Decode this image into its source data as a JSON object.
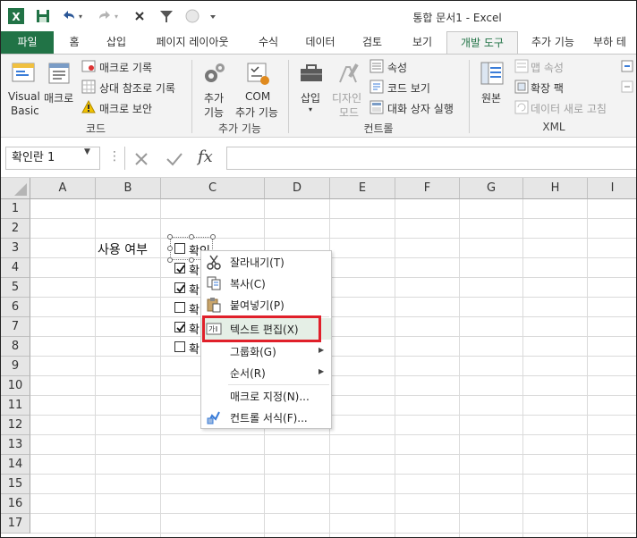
{
  "window": {
    "title": "통합 문서1 - Excel",
    "app_color": "#217346"
  },
  "ribbon": {
    "tabs": [
      {
        "label": "파일"
      },
      {
        "label": "홈"
      },
      {
        "label": "삽입"
      },
      {
        "label": "페이지 레이아웃"
      },
      {
        "label": "수식"
      },
      {
        "label": "데이터"
      },
      {
        "label": "검토"
      },
      {
        "label": "보기"
      },
      {
        "label": "개발 도구"
      },
      {
        "label": "추가 기능"
      },
      {
        "label": "부하 테"
      }
    ],
    "code": {
      "visual_basic_line1": "Visual",
      "visual_basic_line2": "Basic",
      "macro": "매크로",
      "record_macro": "매크로 기록",
      "relative_ref": "상대 참조로 기록",
      "macro_security": "매크로 보안",
      "group_label": "코드"
    },
    "addins": {
      "addins_line1": "추가",
      "addins_line2": "기능",
      "com_line1": "COM",
      "com_line2": "추가 기능",
      "group_label": "추가 기능"
    },
    "controls": {
      "insert": "삽입",
      "design_line1": "디자인",
      "design_line2": "모드",
      "properties": "속성",
      "view_code": "코드 보기",
      "run_dialog": "대화 상자 실행",
      "group_label": "컨트롤"
    },
    "xml": {
      "source": "원본",
      "map_properties": "맵 속성",
      "expansion_packs": "확장 팩",
      "refresh_data": "데이터 새로 고침",
      "group_label": "XML"
    }
  },
  "formula_bar": {
    "name_box": "확인란 1",
    "fx": "fx",
    "value": ""
  },
  "sheet": {
    "columns": [
      "A",
      "B",
      "C",
      "D",
      "E",
      "F",
      "G",
      "H",
      "I"
    ],
    "rows": [
      "1",
      "2",
      "3",
      "4",
      "5",
      "6",
      "7",
      "8",
      "9",
      "10",
      "11",
      "12",
      "13",
      "14",
      "15",
      "16",
      "17"
    ],
    "label_cell": "사용 여부",
    "checkboxes": [
      {
        "label": "확인",
        "checked": false
      },
      {
        "label": "확",
        "checked": true
      },
      {
        "label": "확",
        "checked": true
      },
      {
        "label": "확",
        "checked": false
      },
      {
        "label": "확",
        "checked": true
      },
      {
        "label": "확",
        "checked": false
      }
    ]
  },
  "context_menu": {
    "items": [
      {
        "label": "잘라내기(T)",
        "icon": "scissors-icon"
      },
      {
        "label": "복사(C)",
        "icon": "copy-icon"
      },
      {
        "label": "붙여넣기(P)",
        "icon": "paste-icon"
      },
      {
        "label": "텍스트 편집(X)",
        "icon": "edit-text-icon"
      },
      {
        "label": "그룹화(G)",
        "icon": ""
      },
      {
        "label": "순서(R)",
        "icon": ""
      },
      {
        "label": "매크로 지정(N)...",
        "icon": ""
      },
      {
        "label": "컨트롤 서식(F)...",
        "icon": "format-control-icon"
      }
    ],
    "highlight_color": "#e0202a"
  }
}
